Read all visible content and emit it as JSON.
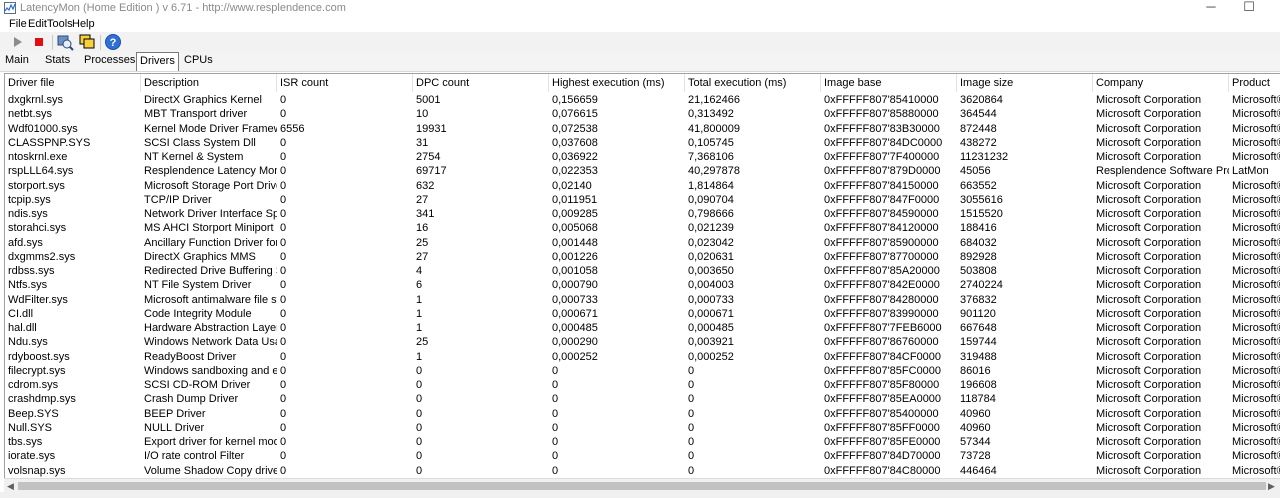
{
  "window": {
    "title": "LatencyMon  (Home Edition )  v 6.71 - http://www.resplendence.com",
    "minimize_glyph": "─",
    "maximize_glyph": "☐"
  },
  "menu": [
    "File",
    "Edit",
    "Tools",
    "Help"
  ],
  "toolbar": {
    "buttons": [
      "play-icon",
      "stop-icon",
      "analyze-icon",
      "windows-icon",
      "help-icon"
    ],
    "help_glyph": "?"
  },
  "tabs": [
    {
      "label": "Main",
      "active": false
    },
    {
      "label": "Stats",
      "active": false
    },
    {
      "label": "Processes",
      "active": false
    },
    {
      "label": "Drivers",
      "active": true
    },
    {
      "label": "CPUs",
      "active": false
    }
  ],
  "columns": [
    "Driver file",
    "Description",
    "ISR count",
    "DPC count",
    "Highest execution (ms)",
    "Total execution (ms)",
    "Image base",
    "Image size",
    "Company",
    "Product"
  ],
  "rows": [
    [
      "dxgkrnl.sys",
      "DirectX Graphics Kernel",
      "0",
      "5001",
      "0,156659",
      "21,162466",
      "0xFFFFF807'85410000",
      "3620864",
      "Microsoft Corporation",
      "Microsoft®"
    ],
    [
      "netbt.sys",
      "MBT Transport driver",
      "0",
      "10",
      "0,076615",
      "0,313492",
      "0xFFFFF807'85880000",
      "364544",
      "Microsoft Corporation",
      "Microsoft®"
    ],
    [
      "Wdf01000.sys",
      "Kernel Mode Driver Framew...",
      "6556",
      "19931",
      "0,072538",
      "41,800009",
      "0xFFFFF807'83B30000",
      "872448",
      "Microsoft Corporation",
      "Microsoft®"
    ],
    [
      "CLASSPNP.SYS",
      "SCSI Class System Dll",
      "0",
      "31",
      "0,037608",
      "0,105745",
      "0xFFFFF807'84DC0000",
      "438272",
      "Microsoft Corporation",
      "Microsoft®"
    ],
    [
      "ntoskrnl.exe",
      "NT Kernel & System",
      "0",
      "2754",
      "0,036922",
      "7,368106",
      "0xFFFFF807'7F400000",
      "11231232",
      "Microsoft Corporation",
      "Microsoft®"
    ],
    [
      "rspLLL64.sys",
      "Resplendence Latency Monit...",
      "0",
      "69717",
      "0,022353",
      "40,297878",
      "0xFFFFF807'879D0000",
      "45056",
      "Resplendence Software Proj...",
      "LatMon"
    ],
    [
      "storport.sys",
      "Microsoft Storage Port Driver",
      "0",
      "632",
      "0,02140",
      "1,814864",
      "0xFFFFF807'84150000",
      "663552",
      "Microsoft Corporation",
      "Microsoft®"
    ],
    [
      "tcpip.sys",
      "TCP/IP Driver",
      "0",
      "27",
      "0,011951",
      "0,090704",
      "0xFFFFF807'847F0000",
      "3055616",
      "Microsoft Corporation",
      "Microsoft®"
    ],
    [
      "ndis.sys",
      "Network Driver Interface Sp...",
      "0",
      "341",
      "0,009285",
      "0,798666",
      "0xFFFFF807'84590000",
      "1515520",
      "Microsoft Corporation",
      "Microsoft®"
    ],
    [
      "storahci.sys",
      "MS AHCI Storport Miniport D...",
      "0",
      "16",
      "0,005068",
      "0,021239",
      "0xFFFFF807'84120000",
      "188416",
      "Microsoft Corporation",
      "Microsoft®"
    ],
    [
      "afd.sys",
      "Ancillary Function Driver for ...",
      "0",
      "25",
      "0,001448",
      "0,023042",
      "0xFFFFF807'85900000",
      "684032",
      "Microsoft Corporation",
      "Microsoft®"
    ],
    [
      "dxgmms2.sys",
      "DirectX Graphics MMS",
      "0",
      "27",
      "0,001226",
      "0,020631",
      "0xFFFFF807'87700000",
      "892928",
      "Microsoft Corporation",
      "Microsoft®"
    ],
    [
      "rdbss.sys",
      "Redirected Drive Buffering S...",
      "0",
      "4",
      "0,001058",
      "0,003650",
      "0xFFFFF807'85A20000",
      "503808",
      "Microsoft Corporation",
      "Microsoft®"
    ],
    [
      "Ntfs.sys",
      "NT File System Driver",
      "0",
      "6",
      "0,000790",
      "0,004003",
      "0xFFFFF807'842E0000",
      "2740224",
      "Microsoft Corporation",
      "Microsoft®"
    ],
    [
      "WdFilter.sys",
      "Microsoft antimalware file sys...",
      "0",
      "1",
      "0,000733",
      "0,000733",
      "0xFFFFF807'84280000",
      "376832",
      "Microsoft Corporation",
      "Microsoft®"
    ],
    [
      "CI.dll",
      "Code Integrity Module",
      "0",
      "1",
      "0,000671",
      "0,000671",
      "0xFFFFF807'83990000",
      "901120",
      "Microsoft Corporation",
      "Microsoft®"
    ],
    [
      "hal.dll",
      "Hardware Abstraction Layer ...",
      "0",
      "1",
      "0,000485",
      "0,000485",
      "0xFFFFF807'7FEB6000",
      "667648",
      "Microsoft Corporation",
      "Microsoft®"
    ],
    [
      "Ndu.sys",
      "Windows Network Data Usa...",
      "0",
      "25",
      "0,000290",
      "0,003921",
      "0xFFFFF807'86760000",
      "159744",
      "Microsoft Corporation",
      "Microsoft®"
    ],
    [
      "rdyboost.sys",
      "ReadyBoost Driver",
      "0",
      "1",
      "0,000252",
      "0,000252",
      "0xFFFFF807'84CF0000",
      "319488",
      "Microsoft Corporation",
      "Microsoft®"
    ],
    [
      "filecrypt.sys",
      "Windows sandboxing and e...",
      "0",
      "0",
      "0",
      "0",
      "0xFFFFF807'85FC0000",
      "86016",
      "Microsoft Corporation",
      "Microsoft®"
    ],
    [
      "cdrom.sys",
      "SCSI CD-ROM Driver",
      "0",
      "0",
      "0",
      "0",
      "0xFFFFF807'85F80000",
      "196608",
      "Microsoft Corporation",
      "Microsoft®"
    ],
    [
      "crashdmp.sys",
      "Crash Dump Driver",
      "0",
      "0",
      "0",
      "0",
      "0xFFFFF807'85EA0000",
      "118784",
      "Microsoft Corporation",
      "Microsoft®"
    ],
    [
      "Beep.SYS",
      "BEEP Driver",
      "0",
      "0",
      "0",
      "0",
      "0xFFFFF807'85400000",
      "40960",
      "Microsoft Corporation",
      "Microsoft®"
    ],
    [
      "Null.SYS",
      "NULL Driver",
      "0",
      "0",
      "0",
      "0",
      "0xFFFFF807'85FF0000",
      "40960",
      "Microsoft Corporation",
      "Microsoft®"
    ],
    [
      "tbs.sys",
      "Export driver for kernel mod...",
      "0",
      "0",
      "0",
      "0",
      "0xFFFFF807'85FE0000",
      "57344",
      "Microsoft Corporation",
      "Microsoft®"
    ],
    [
      "iorate.sys",
      "I/O rate control Filter",
      "0",
      "0",
      "0",
      "0",
      "0xFFFFF807'84D70000",
      "73728",
      "Microsoft Corporation",
      "Microsoft®"
    ],
    [
      "volsnap.sys",
      "Volume Shadow Copy driver",
      "0",
      "0",
      "0",
      "0",
      "0xFFFFF807'84C80000",
      "446464",
      "Microsoft Corporation",
      "Microsoft®"
    ]
  ],
  "scrollbar": {
    "left_arrow": "◀",
    "right_arrow": "▶"
  },
  "colors": {
    "accent": "#2f6fd6",
    "stop": "#e01010",
    "play": "#8c8c8c"
  }
}
